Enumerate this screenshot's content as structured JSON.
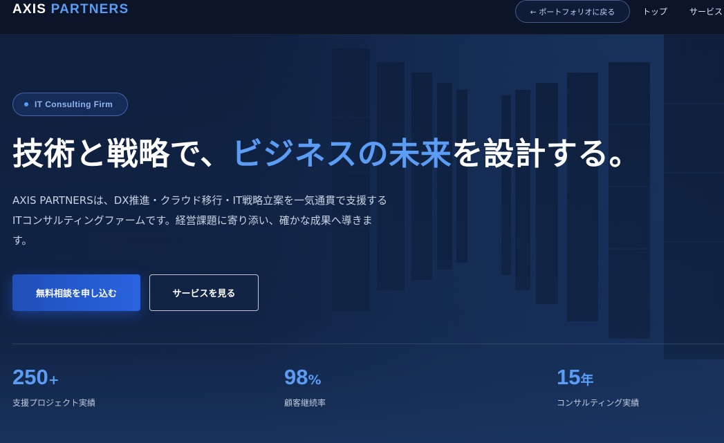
{
  "header": {
    "logo_part1": "AXIS",
    "logo_part2": "PARTNERS",
    "back_button": "← ポートフォリオに戻る",
    "nav": [
      "トップ",
      "サービス"
    ]
  },
  "hero": {
    "badge": "IT Consulting Firm",
    "title_part1": "技術と戦略で、",
    "title_highlight": "ビジネスの未来",
    "title_part2": "を設計する。",
    "description": "AXIS PARTNERSは、DX推進・クラウド移行・IT戦略立案を一気通貫で支援するITコンサルティングファームです。経営課題に寄り添い、確かな成果へ導きます。",
    "primary_button": "無料相談を申し込む",
    "secondary_button": "サービスを見る"
  },
  "stats": [
    {
      "value": "250",
      "suffix": "+",
      "label": "支援プロジェクト実績"
    },
    {
      "value": "98",
      "suffix": "%",
      "label": "顧客継続率"
    },
    {
      "value": "15",
      "suffix": "年",
      "label": "コンサルティング実績"
    }
  ],
  "colors": {
    "accent": "#5b9cf5",
    "background": "#0f1f3d",
    "header": "#0c1428",
    "primary_button": "#2a63e0"
  }
}
